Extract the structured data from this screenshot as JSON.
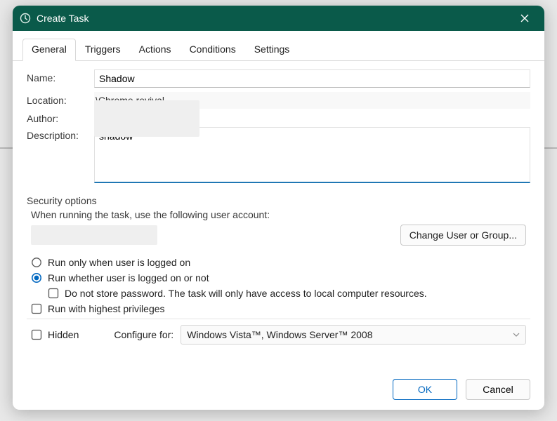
{
  "window": {
    "title": "Create Task"
  },
  "tabs": {
    "general": "General",
    "triggers": "Triggers",
    "actions": "Actions",
    "conditions": "Conditions",
    "settings": "Settings"
  },
  "labels": {
    "name": "Name:",
    "location": "Location:",
    "author": "Author:",
    "description": "Description:",
    "security_options": "Security options",
    "when_running": "When running the task, use the following user account:",
    "change_user": "Change User or Group...",
    "run_logged_on": "Run only when user is logged on",
    "run_whether": "Run whether user is logged on or not",
    "do_not_store": "Do not store password.  The task will only have access to local computer resources.",
    "highest_priv": "Run with highest privileges",
    "hidden": "Hidden",
    "configure_for": "Configure for:"
  },
  "values": {
    "name": "Shadow",
    "location": "\\Chrome revival",
    "description": "shadow",
    "configure_for": "Windows Vista™, Windows Server™ 2008"
  },
  "buttons": {
    "ok": "OK",
    "cancel": "Cancel"
  }
}
